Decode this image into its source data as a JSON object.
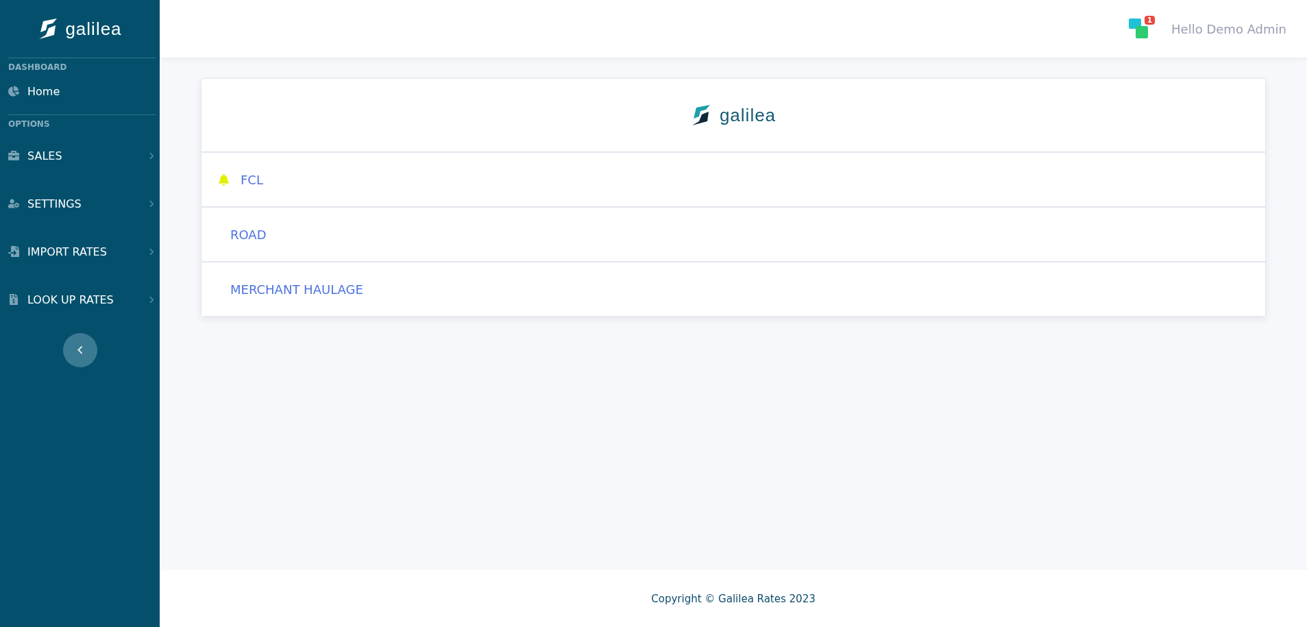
{
  "sidebar": {
    "logo": "galilea",
    "sections": [
      {
        "heading": "DASHBOARD",
        "items": [
          {
            "label": "Home",
            "submenu": false
          }
        ]
      },
      {
        "heading": "OPTIONS",
        "items": [
          {
            "label": "SALES",
            "submenu": true
          },
          {
            "label": "SETTINGS",
            "submenu": true
          },
          {
            "label": "IMPORT RATES",
            "submenu": true
          },
          {
            "label": "LOOK UP RATES",
            "submenu": true
          }
        ]
      }
    ]
  },
  "header": {
    "badge": "1",
    "greeting": "Hello Demo Admin"
  },
  "card": {
    "logo": "galilea",
    "items": [
      {
        "label": "FCL",
        "notified": true
      },
      {
        "label": "ROAD",
        "notified": false
      },
      {
        "label": "MERCHANT HAULAGE",
        "notified": false
      }
    ]
  },
  "footer": {
    "text": "Copyright © Galilea Rates 2023"
  }
}
